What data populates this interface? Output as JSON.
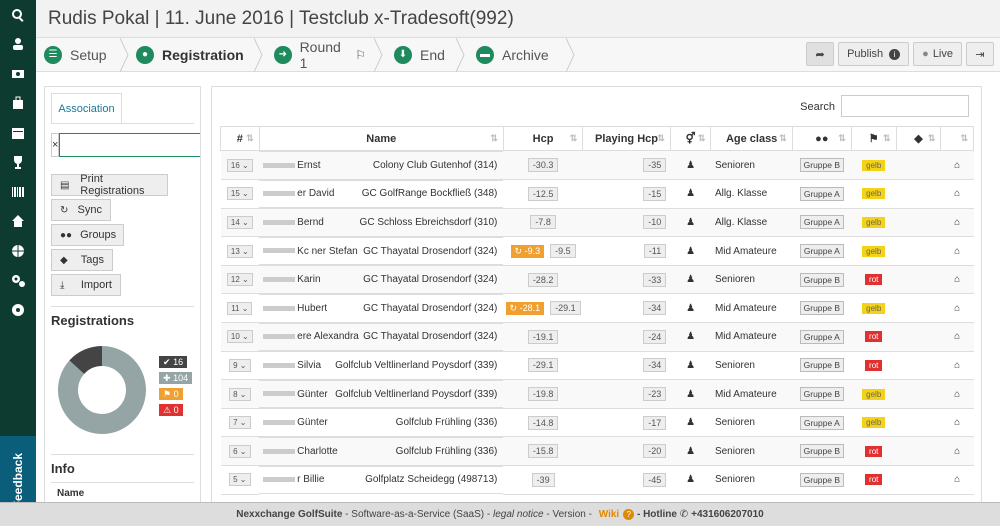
{
  "header": {
    "title": "Rudis Pokal | 11. June 2016 | Testclub x-Tradesoft(992)"
  },
  "steps": [
    {
      "label": "Setup",
      "icon": "list-icon"
    },
    {
      "label": "Registration",
      "icon": "person-icon",
      "active": true
    },
    {
      "label": "Round 1",
      "icon": "arrow-right-icon"
    },
    {
      "label": "End",
      "icon": "arrow-down-icon"
    },
    {
      "label": "Archive",
      "icon": "folder-icon"
    }
  ],
  "topbar": {
    "publish": "Publish",
    "live": "Live"
  },
  "left": {
    "tab": "Association",
    "search_clear": "×",
    "buttons": {
      "print": "Print Registrations",
      "sync": "Sync",
      "groups": "Groups",
      "tags": "Tags",
      "import": "Import"
    },
    "registrations_title": "Registrations",
    "badges": {
      "confirmed": "16",
      "added": "104",
      "yellow": "0",
      "red": "0"
    },
    "info_title": "Info",
    "info_name": "Name"
  },
  "colors": {
    "sidebar": "#0e3b2f",
    "accent": "#1e8a5e",
    "gelb": "#f3d218",
    "rot": "#e03030",
    "donut_main": "#95a5a6",
    "donut_dark": "#444"
  },
  "donut": {
    "confirmed": 16,
    "other": 104
  },
  "search": {
    "label": "Search"
  },
  "table": {
    "headers": [
      "#",
      "Name",
      "Hcp",
      "Playing Hcp",
      "",
      "Age class",
      "",
      "",
      "",
      ""
    ],
    "rows": [
      {
        "n": "16",
        "name": "Ernst",
        "club": "Colony Club Gutenhof (314)",
        "fix": "",
        "hcp": "-30.3",
        "phcp": "-35",
        "age": "Senioren",
        "group": "Gruppe B",
        "flag": "gelb"
      },
      {
        "n": "15",
        "name": "er David",
        "club": "GC GolfRange Bockfließ (348)",
        "fix": "",
        "hcp": "-12.5",
        "phcp": "-15",
        "age": "Allg. Klasse",
        "group": "Gruppe A",
        "flag": "gelb"
      },
      {
        "n": "14",
        "name": "Bernd",
        "club": "GC Schloss Ebreichsdorf (310)",
        "fix": "",
        "hcp": "-7.8",
        "phcp": "-10",
        "age": "Allg. Klasse",
        "group": "Gruppe A",
        "flag": "gelb"
      },
      {
        "n": "13",
        "name": "Kc ner Stefan",
        "club": "GC Thayatal Drosendorf (324)",
        "fix": "-9.3",
        "hcp": "-9.5",
        "phcp": "-11",
        "age": "Mid Amateure",
        "group": "Gruppe A",
        "flag": "gelb"
      },
      {
        "n": "12",
        "name": "Karin",
        "club": "GC Thayatal Drosendorf (324)",
        "fix": "",
        "hcp": "-28.2",
        "phcp": "-33",
        "age": "Senioren",
        "group": "Gruppe B",
        "flag": "rot"
      },
      {
        "n": "11",
        "name": "Hubert",
        "club": "GC Thayatal Drosendorf (324)",
        "fix": "-28.1",
        "hcp": "-29.1",
        "phcp": "-34",
        "age": "Mid Amateure",
        "group": "Gruppe B",
        "flag": "gelb"
      },
      {
        "n": "10",
        "name": "ere Alexandra",
        "club": "GC Thayatal Drosendorf (324)",
        "fix": "",
        "hcp": "-19.1",
        "phcp": "-24",
        "age": "Mid Amateure",
        "group": "Gruppe A",
        "flag": "rot"
      },
      {
        "n": "9",
        "name": "Silvia",
        "club": "Golfclub Veltlinerland Poysdorf (339)",
        "fix": "",
        "hcp": "-29.1",
        "phcp": "-34",
        "age": "Senioren",
        "group": "Gruppe B",
        "flag": "rot"
      },
      {
        "n": "8",
        "name": "Günter",
        "club": "Golfclub Veltlinerland Poysdorf (339)",
        "fix": "",
        "hcp": "-19.8",
        "phcp": "-23",
        "age": "Mid Amateure",
        "group": "Gruppe B",
        "flag": "gelb"
      },
      {
        "n": "7",
        "name": "Günter",
        "club": "Golfclub Frühling (336)",
        "fix": "",
        "hcp": "-14.8",
        "phcp": "-17",
        "age": "Senioren",
        "group": "Gruppe A",
        "flag": "gelb"
      },
      {
        "n": "6",
        "name": "Charlotte",
        "club": "Golfclub Frühling (336)",
        "fix": "",
        "hcp": "-15.8",
        "phcp": "-20",
        "age": "Senioren",
        "group": "Gruppe B",
        "flag": "rot"
      },
      {
        "n": "5",
        "name": "r Billie",
        "club": "Golfplatz Scheidegg (498713)",
        "fix": "",
        "hcp": "-39",
        "phcp": "-45",
        "age": "Senioren",
        "group": "Gruppe B",
        "flag": "rot"
      }
    ]
  },
  "footer": {
    "brand": "Nexxchange GolfSuite",
    "text1": " - Software-as-a-Service (SaaS) - ",
    "legal": "legal notice",
    "text2": " - Version - ",
    "wiki": "Wiki",
    "text3": " - Hotline ",
    "phone": "+431606207010"
  }
}
